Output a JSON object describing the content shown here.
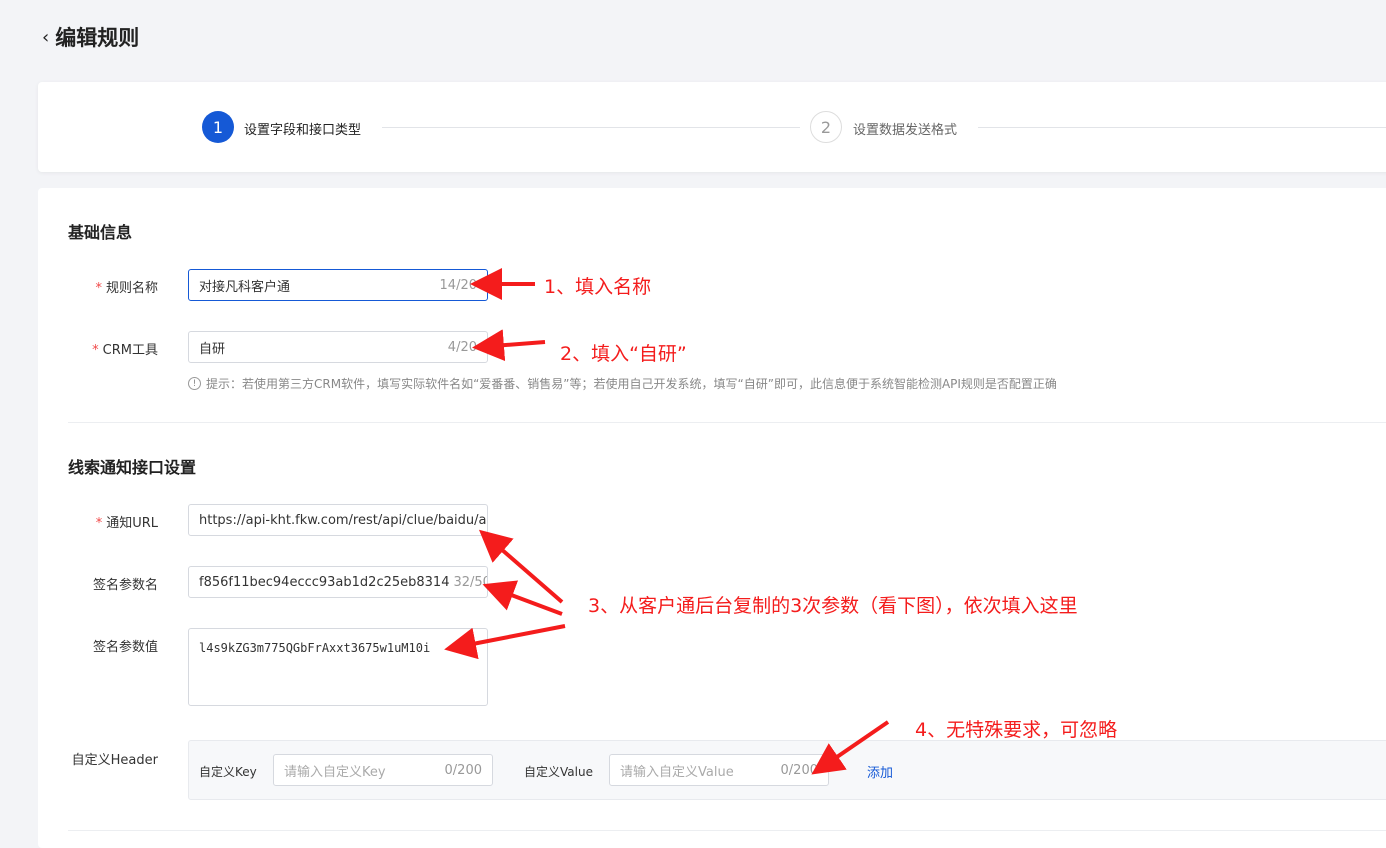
{
  "page_title": "编辑规则",
  "steps": [
    {
      "num": "1",
      "label": "设置字段和接口类型"
    },
    {
      "num": "2",
      "label": "设置数据发送格式"
    }
  ],
  "basic": {
    "title": "基础信息",
    "rule_name": {
      "label": "规则名称",
      "value": "对接凡科客户通",
      "count": "14/20"
    },
    "crm": {
      "label": "CRM工具",
      "value": "自研",
      "count": "4/20"
    },
    "hint": "提示：若使用第三方CRM软件，填写实际软件名如“爱番番、销售易”等；若使用自己开发系统，填写“自研”即可，此信息便于系统智能检测API规则是否配置正确"
  },
  "notify": {
    "title": "线索通知接口设置",
    "url": {
      "label": "通知URL",
      "value": "https://api-kht.fkw.com/rest/api/clue/baidu/ad"
    },
    "sign_name": {
      "label": "签名参数名",
      "value": "f856f11bec94eccc93ab1d2c25eb8314",
      "count": "32/50"
    },
    "sign_value": {
      "label": "签名参数值",
      "value": "l4s9kZG3m775QGbFrAxxt3675w1uM10i"
    },
    "header": {
      "label": "自定义Header",
      "key_label": "自定义Key",
      "key_placeholder": "请输入自定义Key",
      "key_count": "0/200",
      "value_label": "自定义Value",
      "value_placeholder": "请输入自定义Value",
      "value_count": "0/200",
      "add": "添加"
    }
  },
  "annotations": [
    "1、填入名称",
    "2、填入“自研”",
    "3、从客户通后台复制的3次参数（看下图），依次填入这里",
    "4、无特殊要求，可忽略"
  ],
  "colors": {
    "primary": "#1559d6",
    "annotation": "#f41c1c"
  }
}
